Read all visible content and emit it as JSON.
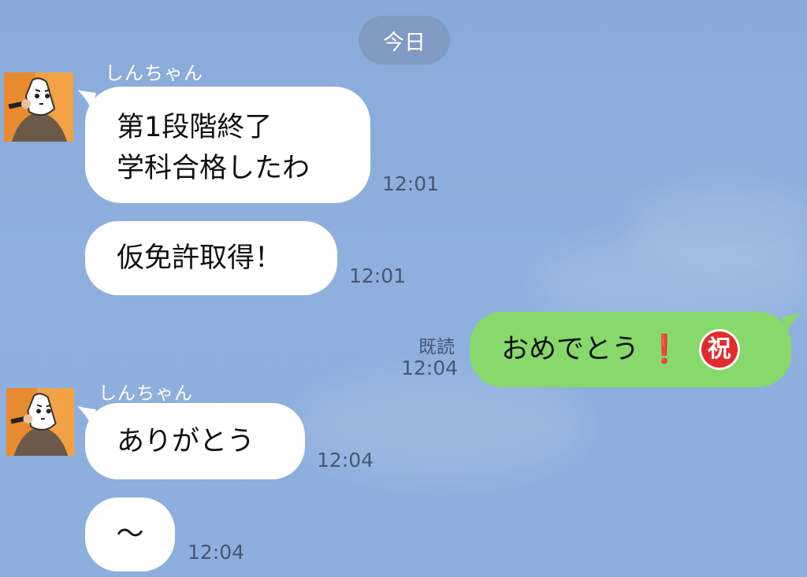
{
  "date_separator": "今日",
  "messages": [
    {
      "sender": "しんちゃん",
      "lines": [
        "第1段階終了",
        "学科合格したわ"
      ],
      "time": "12:01"
    },
    {
      "sender": "しんちゃん",
      "text": "仮免許取得！",
      "time": "12:01"
    },
    {
      "sender": "me",
      "text": "おめでとう",
      "emoji": "❗",
      "stamp": "祝",
      "read": "既読",
      "time": "12:04"
    },
    {
      "sender": "しんちゃん",
      "text": "ありがとう",
      "time": "12:04"
    },
    {
      "sender": "しんちゃん",
      "text": "〜",
      "time": "12:04"
    }
  ],
  "colors": {
    "background": "#8aaad9",
    "incoming_bubble": "#ffffff",
    "outgoing_bubble": "#86d96a"
  }
}
